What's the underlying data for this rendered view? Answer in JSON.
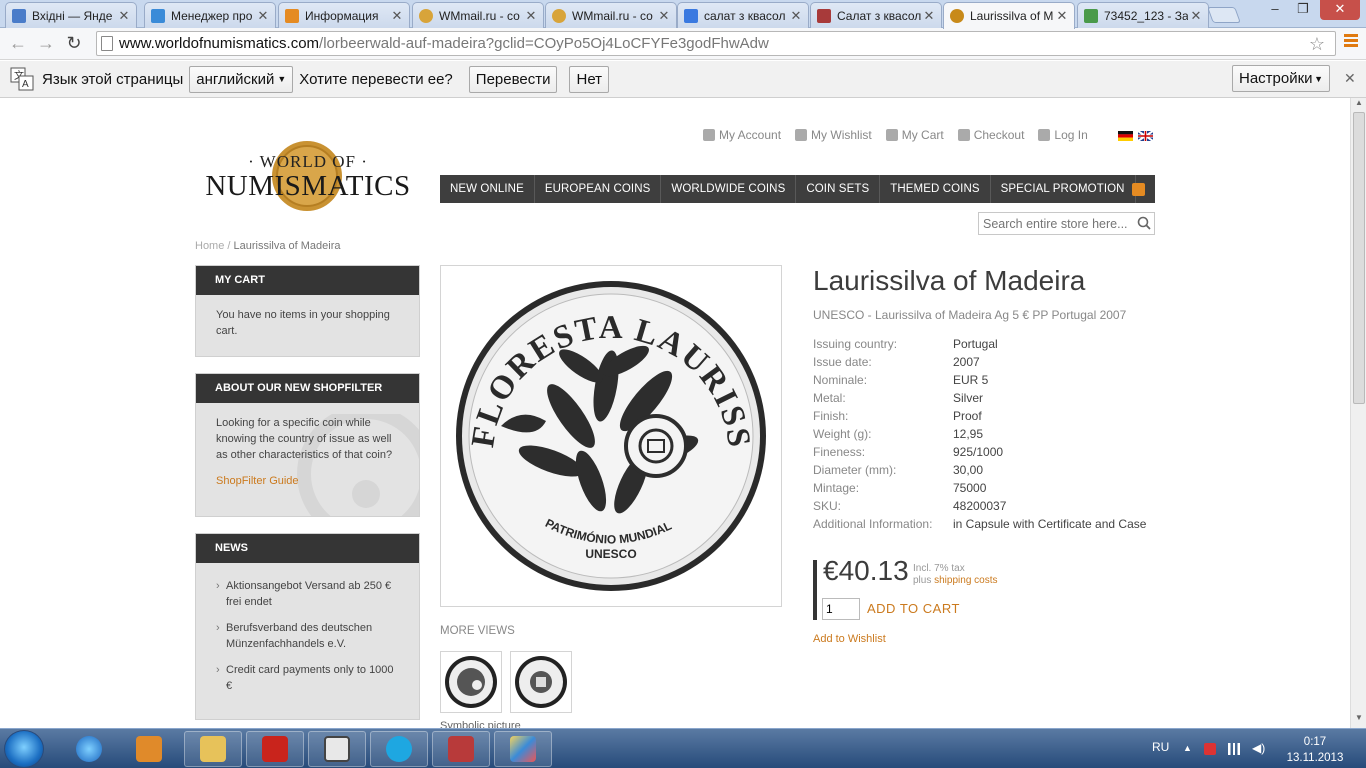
{
  "browser": {
    "tabs": [
      {
        "title": "Вхідні — Янде",
        "icon": "mail-icon",
        "color": "#4a7cc9"
      },
      {
        "title": "Менеджер про",
        "icon": "chart-icon",
        "color": "#3a8bd8"
      },
      {
        "title": "Информация",
        "icon": "amazon-icon",
        "color": "#e58b22"
      },
      {
        "title": "WMmail.ru - со",
        "icon": "coin-icon",
        "color": "#d8a43a"
      },
      {
        "title": "WMmail.ru - со",
        "icon": "coin-icon",
        "color": "#d8a43a"
      },
      {
        "title": "салат з квасол",
        "icon": "google-icon",
        "color": "#3a79e0"
      },
      {
        "title": "Салат з квасол",
        "icon": "page-icon",
        "color": "#a83a3a"
      },
      {
        "title": "Laurissilva of M",
        "icon": "coin-icon",
        "color": "#c88a1a",
        "active": true
      },
      {
        "title": "73452_123 - За",
        "icon": "image-icon",
        "color": "#4a9a4a"
      }
    ],
    "url_host": "www.worldofnumismatics.com",
    "url_path": "/lorbeerwald-auf-madeira?gclid=COyPo5Oj4LoCFYFe3godFhwAdw"
  },
  "translate_bar": {
    "prompt_lang": "Язык этой страницы",
    "lang_value": "английский",
    "question": "Хотите перевести ее?",
    "translate_button": "Перевести",
    "no_button": "Нет",
    "settings_button": "Настройки"
  },
  "site": {
    "logo_top": "· WORLD OF ·",
    "logo_main": "NUMISMATICS",
    "header_links": [
      "My Account",
      "My Wishlist",
      "My Cart",
      "Checkout",
      "Log In"
    ],
    "nav": [
      "NEW ONLINE",
      "EUROPEAN COINS",
      "WORLDWIDE COINS",
      "COIN SETS",
      "THEMED COINS",
      "SPECIAL PROMOTION"
    ],
    "search_placeholder": "Search entire store here...",
    "breadcrumb_home": "Home",
    "breadcrumb_sep": " / ",
    "breadcrumb_current": "Laurissilva of Madeira"
  },
  "sidebar": {
    "cart_title": "MY CART",
    "cart_text": "You have no items in your shopping cart.",
    "shopfilter_title": "ABOUT OUR NEW SHOPFILTER",
    "shopfilter_text": "Looking for a specific coin while knowing the country of issue as well as other characteristics of that coin?",
    "shopfilter_link": "ShopFilter Guide",
    "news_title": "NEWS",
    "news": [
      "Aktionsangebot Versand ab 250 € frei endet",
      "Berufsverband des deutschen Münzenfachhandels e.V.",
      "Credit card payments only to 1000 €"
    ]
  },
  "product": {
    "title": "Laurissilva of Madeira",
    "subtitle": "UNESCO - Laurissilva of Madeira Ag 5 € PP Portugal 2007",
    "coin_text_ring": "FLORESTA LAURISSILVA DA MADEIRA",
    "coin_text_bottom1": "UNESCO",
    "coin_text_bottom2": "PATRIMÓNIO MUNDIAL",
    "attributes": [
      {
        "k": "Issuing country:",
        "v": "Portugal"
      },
      {
        "k": "Issue date:",
        "v": "2007"
      },
      {
        "k": "Nominale:",
        "v": "EUR 5"
      },
      {
        "k": "Metal:",
        "v": "Silver"
      },
      {
        "k": "Finish:",
        "v": "Proof"
      },
      {
        "k": "Weight (g):",
        "v": "12,95"
      },
      {
        "k": "Fineness:",
        "v": "925/1000"
      },
      {
        "k": "Diameter (mm):",
        "v": "30,00"
      },
      {
        "k": "Mintage:",
        "v": "75000"
      },
      {
        "k": "SKU:",
        "v": "48200037"
      },
      {
        "k": "Additional Information:",
        "v": "in Capsule with Certificate and Case"
      }
    ],
    "price": "€40.13",
    "tax_line": "Incl. 7% tax",
    "shipping_prefix": "plus ",
    "shipping_link": "shipping costs",
    "qty": "1",
    "add_to_cart": "ADD TO CART",
    "add_to_wishlist": "Add to Wishlist",
    "more_views": "MORE VIEWS",
    "symbolic": "Symbolic picture"
  },
  "taskbar": {
    "lang": "RU",
    "time": "0:17",
    "date": "13.11.2013"
  },
  "colors": {
    "accent": "#cb7a1e",
    "nav_bg": "#3e3e3e",
    "sidebar_header": "#353535"
  }
}
